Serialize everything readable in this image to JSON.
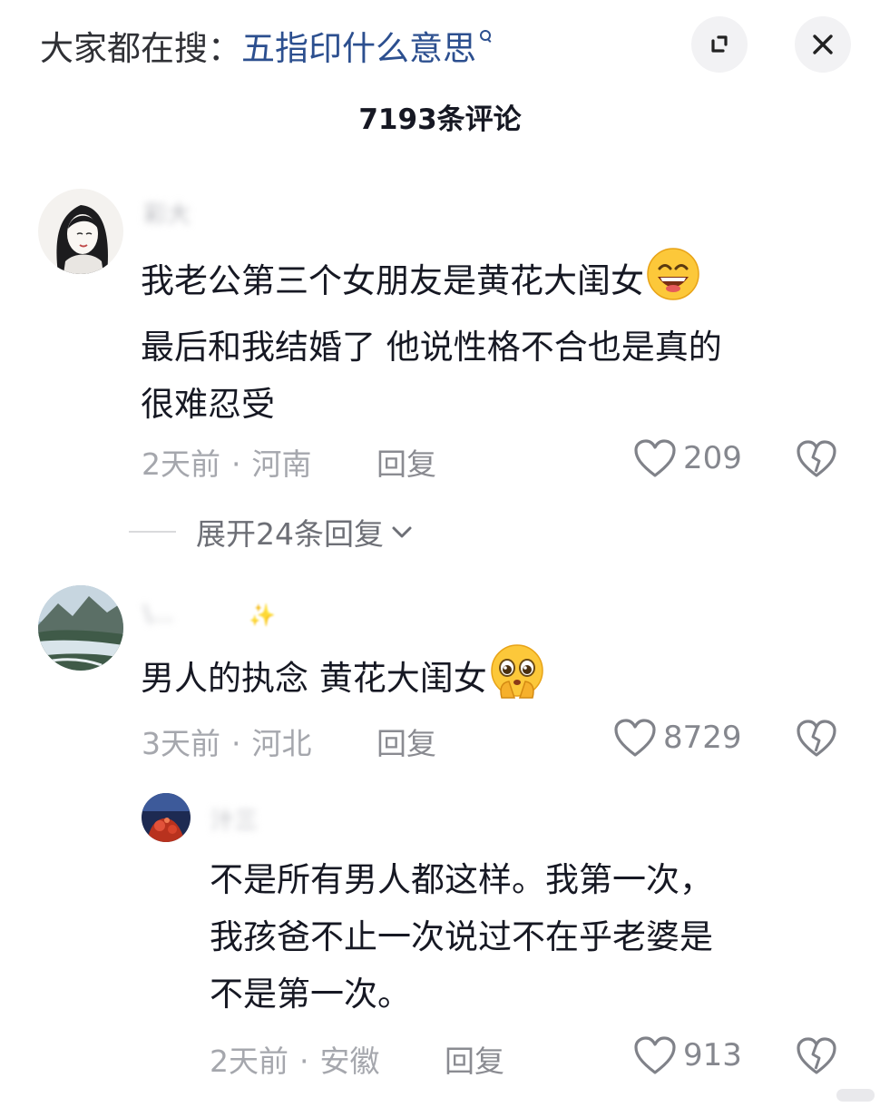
{
  "header": {
    "search_prefix": "大家都在搜：",
    "search_query": "五指印什么意思",
    "comment_count": "7193条评论"
  },
  "comments": [
    {
      "username": "彩大",
      "lines": [
        "我老公第三个女朋友是黄花大闺女",
        "最后和我结婚了 他说性格不合也是真的",
        "很难忍受"
      ],
      "time": "2天前",
      "location": "河南",
      "reply_label": "回复",
      "likes": "209",
      "expand_label": "展开24条回复"
    },
    {
      "username": "\\...",
      "lines": [
        "男人的执念 黄花大闺女"
      ],
      "time": "3天前",
      "location": "河北",
      "reply_label": "回复",
      "likes": "8729",
      "reply": {
        "username": "汁三",
        "lines": [
          "不是所有男人都这样。我第一次，",
          "我孩爸不止一次说过不在乎老婆是",
          "不是第一次。"
        ],
        "time": "2天前",
        "location": "安徽",
        "reply_label": "回复",
        "likes": "913"
      }
    }
  ]
}
